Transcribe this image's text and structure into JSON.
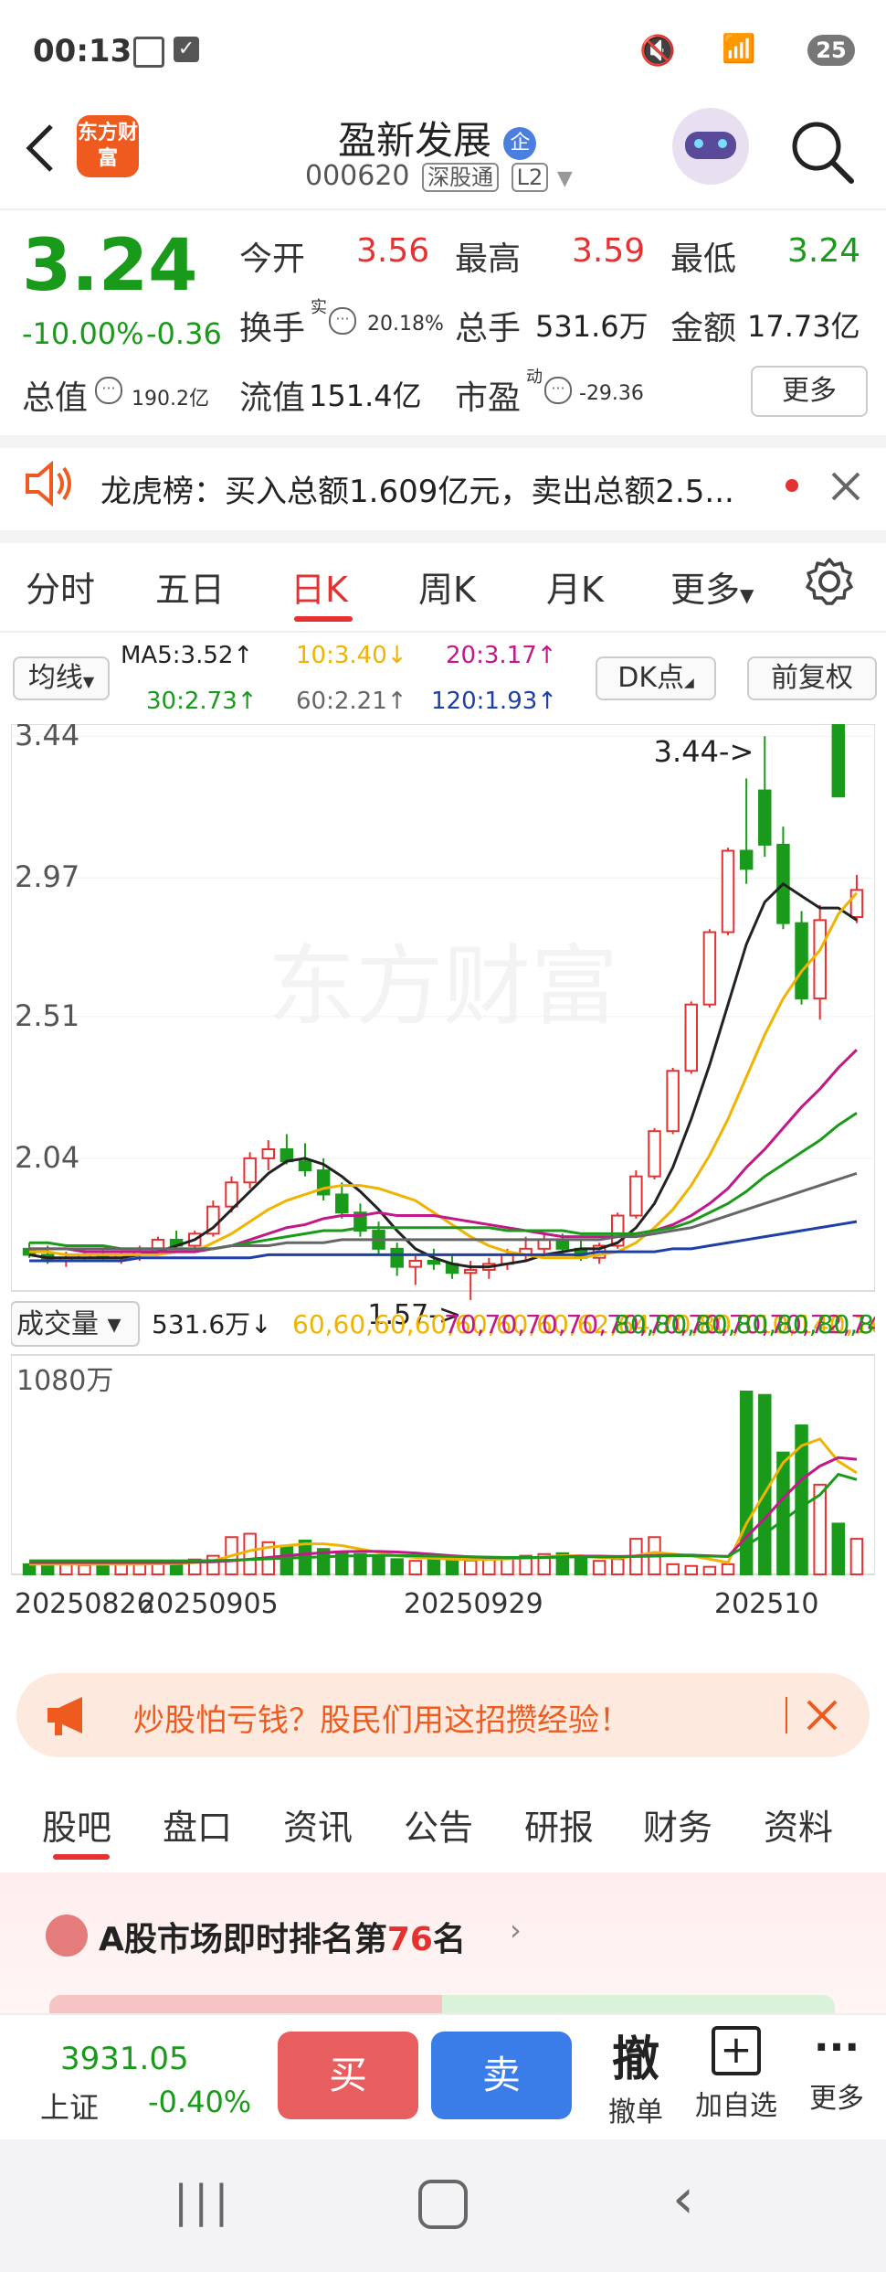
{
  "status_bar": {
    "time": "00:13",
    "battery": "25"
  },
  "header": {
    "logo_text": "东方财富",
    "stock_name": "盈新发展",
    "badge": "企",
    "code": "000620",
    "exchange_tag": "深股通",
    "level_tag": "L2"
  },
  "quote": {
    "price": "3.24",
    "change_pct": "-10.00%",
    "change": "-0.36",
    "open_label": "今开",
    "open": "3.56",
    "high_label": "最高",
    "high": "3.59",
    "low_label": "最低",
    "low": "3.24",
    "turnover_label": "换手",
    "turnover_sup": "实",
    "turnover": "20.18%",
    "volume_label": "总手",
    "volume": "531.6万",
    "amount_label": "金额",
    "amount": "17.73亿",
    "mktcap_label": "总值",
    "mktcap": "190.2亿",
    "float_label": "流值",
    "float_cap": "151.4亿",
    "pe_label": "市盈",
    "pe_sup": "动",
    "pe": "-29.36",
    "more": "更多"
  },
  "notice": {
    "text": "龙虎榜：买入总额1.609亿元，卖出总额2.5..."
  },
  "period_tabs": [
    "分时",
    "五日",
    "日K",
    "周K",
    "月K",
    "更多"
  ],
  "ma_bar": {
    "selector": "均线",
    "ma5": "MA5:3.52↑",
    "ma10": "10:3.40↓",
    "ma20": "20:3.17↑",
    "ma30": "30:2.73↑",
    "ma60": "60:2.21↑",
    "ma120": "120:1.93↑",
    "dk": "DK点",
    "fq": "前复权"
  },
  "chart_data": {
    "type": "candlestick",
    "y_ticks": [
      "3.44",
      "2.97",
      "2.51",
      "2.04"
    ],
    "ylim": [
      1.6,
      3.48
    ],
    "max_label": "3.44->",
    "min_label": "1.57->",
    "watermark": "东方财富",
    "x_ticks": [
      "20250826",
      "20250905",
      "20250929",
      "202510"
    ],
    "candles": [
      [
        1.74,
        1.76,
        1.71,
        1.72
      ],
      [
        1.72,
        1.75,
        1.69,
        1.7
      ],
      [
        1.7,
        1.73,
        1.68,
        1.71
      ],
      [
        1.71,
        1.74,
        1.7,
        1.72
      ],
      [
        1.72,
        1.74,
        1.7,
        1.71
      ],
      [
        1.71,
        1.73,
        1.69,
        1.72
      ],
      [
        1.72,
        1.75,
        1.7,
        1.73
      ],
      [
        1.73,
        1.78,
        1.72,
        1.77
      ],
      [
        1.77,
        1.8,
        1.74,
        1.75
      ],
      [
        1.75,
        1.8,
        1.74,
        1.79
      ],
      [
        1.79,
        1.9,
        1.78,
        1.88
      ],
      [
        1.88,
        1.98,
        1.86,
        1.96
      ],
      [
        1.96,
        2.06,
        1.94,
        2.04
      ],
      [
        2.04,
        2.1,
        2.0,
        2.07
      ],
      [
        2.07,
        2.12,
        2.02,
        2.03
      ],
      [
        2.03,
        2.09,
        1.98,
        2.0
      ],
      [
        2.0,
        2.04,
        1.9,
        1.92
      ],
      [
        1.92,
        1.96,
        1.84,
        1.86
      ],
      [
        1.86,
        1.89,
        1.78,
        1.8
      ],
      [
        1.8,
        1.83,
        1.72,
        1.74
      ],
      [
        1.74,
        1.76,
        1.65,
        1.68
      ],
      [
        1.68,
        1.72,
        1.62,
        1.7
      ],
      [
        1.7,
        1.74,
        1.67,
        1.69
      ],
      [
        1.69,
        1.72,
        1.64,
        1.66
      ],
      [
        1.66,
        1.7,
        1.57,
        1.67
      ],
      [
        1.67,
        1.71,
        1.64,
        1.69
      ],
      [
        1.69,
        1.74,
        1.67,
        1.72
      ],
      [
        1.72,
        1.78,
        1.7,
        1.74
      ],
      [
        1.74,
        1.79,
        1.72,
        1.77
      ],
      [
        1.77,
        1.79,
        1.72,
        1.74
      ],
      [
        1.74,
        1.77,
        1.7,
        1.71
      ],
      [
        1.71,
        1.76,
        1.69,
        1.75
      ],
      [
        1.75,
        1.86,
        1.74,
        1.85
      ],
      [
        1.85,
        2.0,
        1.84,
        1.98
      ],
      [
        1.98,
        2.14,
        1.97,
        2.13
      ],
      [
        2.13,
        2.34,
        2.12,
        2.33
      ],
      [
        2.33,
        2.56,
        2.32,
        2.55
      ],
      [
        2.55,
        2.8,
        2.54,
        2.79
      ],
      [
        2.79,
        3.07,
        2.78,
        3.06
      ],
      [
        3.06,
        3.3,
        2.95,
        3.0
      ],
      [
        3.26,
        3.44,
        3.04,
        3.08
      ],
      [
        3.08,
        3.14,
        2.8,
        2.82
      ],
      [
        2.82,
        2.86,
        2.55,
        2.57
      ],
      [
        2.57,
        2.88,
        2.5,
        2.83
      ],
      [
        3.56,
        3.59,
        3.24,
        3.24
      ],
      [
        2.84,
        2.98,
        2.82,
        2.93
      ]
    ],
    "ma_series": [
      {
        "name": "MA5",
        "color": "#222222",
        "values": [
          1.72,
          1.71,
          1.71,
          1.71,
          1.71,
          1.71,
          1.72,
          1.73,
          1.75,
          1.77,
          1.81,
          1.87,
          1.93,
          1.99,
          2.03,
          2.04,
          2.02,
          1.98,
          1.93,
          1.87,
          1.8,
          1.74,
          1.71,
          1.69,
          1.68,
          1.68,
          1.69,
          1.7,
          1.72,
          1.73,
          1.74,
          1.74,
          1.76,
          1.81,
          1.89,
          2.01,
          2.17,
          2.35,
          2.55,
          2.75,
          2.89,
          2.95,
          2.91,
          2.87,
          2.87,
          2.83
        ]
      },
      {
        "name": "MA10",
        "color": "#f0b400",
        "values": [
          1.73,
          1.73,
          1.72,
          1.72,
          1.72,
          1.72,
          1.72,
          1.72,
          1.73,
          1.73,
          1.76,
          1.79,
          1.83,
          1.87,
          1.9,
          1.92,
          1.94,
          1.95,
          1.95,
          1.94,
          1.92,
          1.9,
          1.86,
          1.82,
          1.78,
          1.75,
          1.73,
          1.72,
          1.71,
          1.71,
          1.71,
          1.72,
          1.73,
          1.76,
          1.81,
          1.87,
          1.95,
          2.05,
          2.17,
          2.31,
          2.45,
          2.57,
          2.66,
          2.73,
          2.85,
          2.92
        ]
      },
      {
        "name": "MA20",
        "color": "#c2188a",
        "values": [
          1.74,
          1.74,
          1.74,
          1.73,
          1.73,
          1.73,
          1.73,
          1.73,
          1.73,
          1.73,
          1.74,
          1.75,
          1.77,
          1.79,
          1.81,
          1.82,
          1.84,
          1.85,
          1.85,
          1.86,
          1.85,
          1.85,
          1.85,
          1.84,
          1.83,
          1.82,
          1.81,
          1.8,
          1.79,
          1.78,
          1.78,
          1.78,
          1.78,
          1.79,
          1.8,
          1.82,
          1.85,
          1.89,
          1.94,
          2.01,
          2.07,
          2.14,
          2.21,
          2.27,
          2.34,
          2.4
        ]
      },
      {
        "name": "MA30",
        "color": "#1a9a1a",
        "values": [
          1.76,
          1.76,
          1.75,
          1.75,
          1.75,
          1.74,
          1.74,
          1.74,
          1.74,
          1.74,
          1.74,
          1.75,
          1.76,
          1.77,
          1.78,
          1.79,
          1.8,
          1.8,
          1.81,
          1.81,
          1.81,
          1.81,
          1.81,
          1.81,
          1.81,
          1.81,
          1.8,
          1.8,
          1.8,
          1.8,
          1.79,
          1.79,
          1.79,
          1.79,
          1.8,
          1.81,
          1.83,
          1.86,
          1.89,
          1.93,
          1.98,
          2.02,
          2.06,
          2.1,
          2.15,
          2.19
        ]
      },
      {
        "name": "MA60",
        "color": "#666666",
        "values": [
          1.74,
          1.74,
          1.74,
          1.74,
          1.74,
          1.74,
          1.74,
          1.74,
          1.74,
          1.74,
          1.74,
          1.75,
          1.75,
          1.75,
          1.76,
          1.76,
          1.76,
          1.77,
          1.77,
          1.77,
          1.77,
          1.77,
          1.77,
          1.77,
          1.77,
          1.77,
          1.77,
          1.77,
          1.77,
          1.77,
          1.77,
          1.77,
          1.78,
          1.78,
          1.79,
          1.8,
          1.81,
          1.83,
          1.85,
          1.87,
          1.89,
          1.91,
          1.93,
          1.95,
          1.97,
          1.99
        ]
      },
      {
        "name": "MA120",
        "color": "#1f3fa8",
        "values": [
          1.7,
          1.7,
          1.7,
          1.7,
          1.7,
          1.7,
          1.71,
          1.71,
          1.71,
          1.71,
          1.71,
          1.71,
          1.71,
          1.72,
          1.72,
          1.72,
          1.72,
          1.72,
          1.72,
          1.72,
          1.72,
          1.72,
          1.72,
          1.72,
          1.72,
          1.72,
          1.72,
          1.72,
          1.72,
          1.72,
          1.72,
          1.73,
          1.73,
          1.73,
          1.73,
          1.74,
          1.74,
          1.75,
          1.76,
          1.77,
          1.78,
          1.79,
          1.8,
          1.81,
          1.82,
          1.83
        ]
      }
    ],
    "volume": {
      "label": "成交量",
      "current": "531.6万↓",
      "ma1": [
        60,
        60,
        60,
        60,
        60,
        60,
        60,
        62,
        64,
        70,
        80,
        110,
        140,
        160,
        170,
        180,
        180,
        170,
        150,
        130,
        110,
        100,
        95,
        90,
        88,
        88,
        92,
        98,
        104,
        110,
        110,
        100,
        95,
        110,
        130,
        120,
        110,
        90,
        70,
        300,
        480,
        660,
        760,
        800,
        668,
        600
      ],
      "ma2": [
        70,
        70,
        70,
        70,
        70,
        70,
        70,
        70,
        70,
        72,
        74,
        80,
        90,
        100,
        110,
        120,
        128,
        134,
        136,
        136,
        132,
        126,
        118,
        110,
        104,
        100,
        98,
        98,
        100,
        104,
        108,
        108,
        106,
        108,
        112,
        114,
        114,
        110,
        106,
        220,
        330,
        450,
        560,
        640,
        690,
        680
      ],
      "ma3": [
        80,
        80,
        80,
        80,
        80,
        80,
        80,
        80,
        80,
        80,
        82,
        84,
        88,
        92,
        96,
        100,
        104,
        108,
        110,
        112,
        112,
        110,
        108,
        106,
        104,
        102,
        100,
        100,
        100,
        102,
        104,
        104,
        104,
        106,
        108,
        110,
        110,
        108,
        106,
        170,
        240,
        320,
        400,
        470,
        591,
        560
      ],
      "ylabel": "1080万",
      "ymax": 1080,
      "values": [
        60,
        62,
        58,
        55,
        60,
        58,
        62,
        70,
        72,
        88,
        110,
        220,
        240,
        190,
        170,
        200,
        150,
        130,
        120,
        100,
        90,
        80,
        95,
        88,
        82,
        90,
        100,
        110,
        120,
        125,
        100,
        80,
        90,
        210,
        220,
        60,
        50,
        45,
        60,
        1080,
        1060,
        720,
        880,
        530,
        300,
        210
      ]
    }
  },
  "ad_banner": {
    "text": "炒股怕亏钱？股民们用这招攒经验！"
  },
  "bottom_tabs": [
    "股吧",
    "盘口",
    "资讯",
    "公告",
    "研报",
    "财务",
    "资料"
  ],
  "ranking": {
    "prefix": "A股市场即时排名第",
    "rank": "76",
    "suffix": "名"
  },
  "trade_bar": {
    "index_value": "3931.05",
    "index_name": "上证",
    "index_change": "-0.40%",
    "buy": "买",
    "sell": "卖",
    "cancel_icon": "撤",
    "cancel": "撤单",
    "watchlist": "加自选",
    "more": "更多"
  },
  "colors": {
    "up": "#e5312f",
    "down": "#1a9a1a",
    "accent": "#e5312f",
    "brand": "#ef5a1f"
  }
}
